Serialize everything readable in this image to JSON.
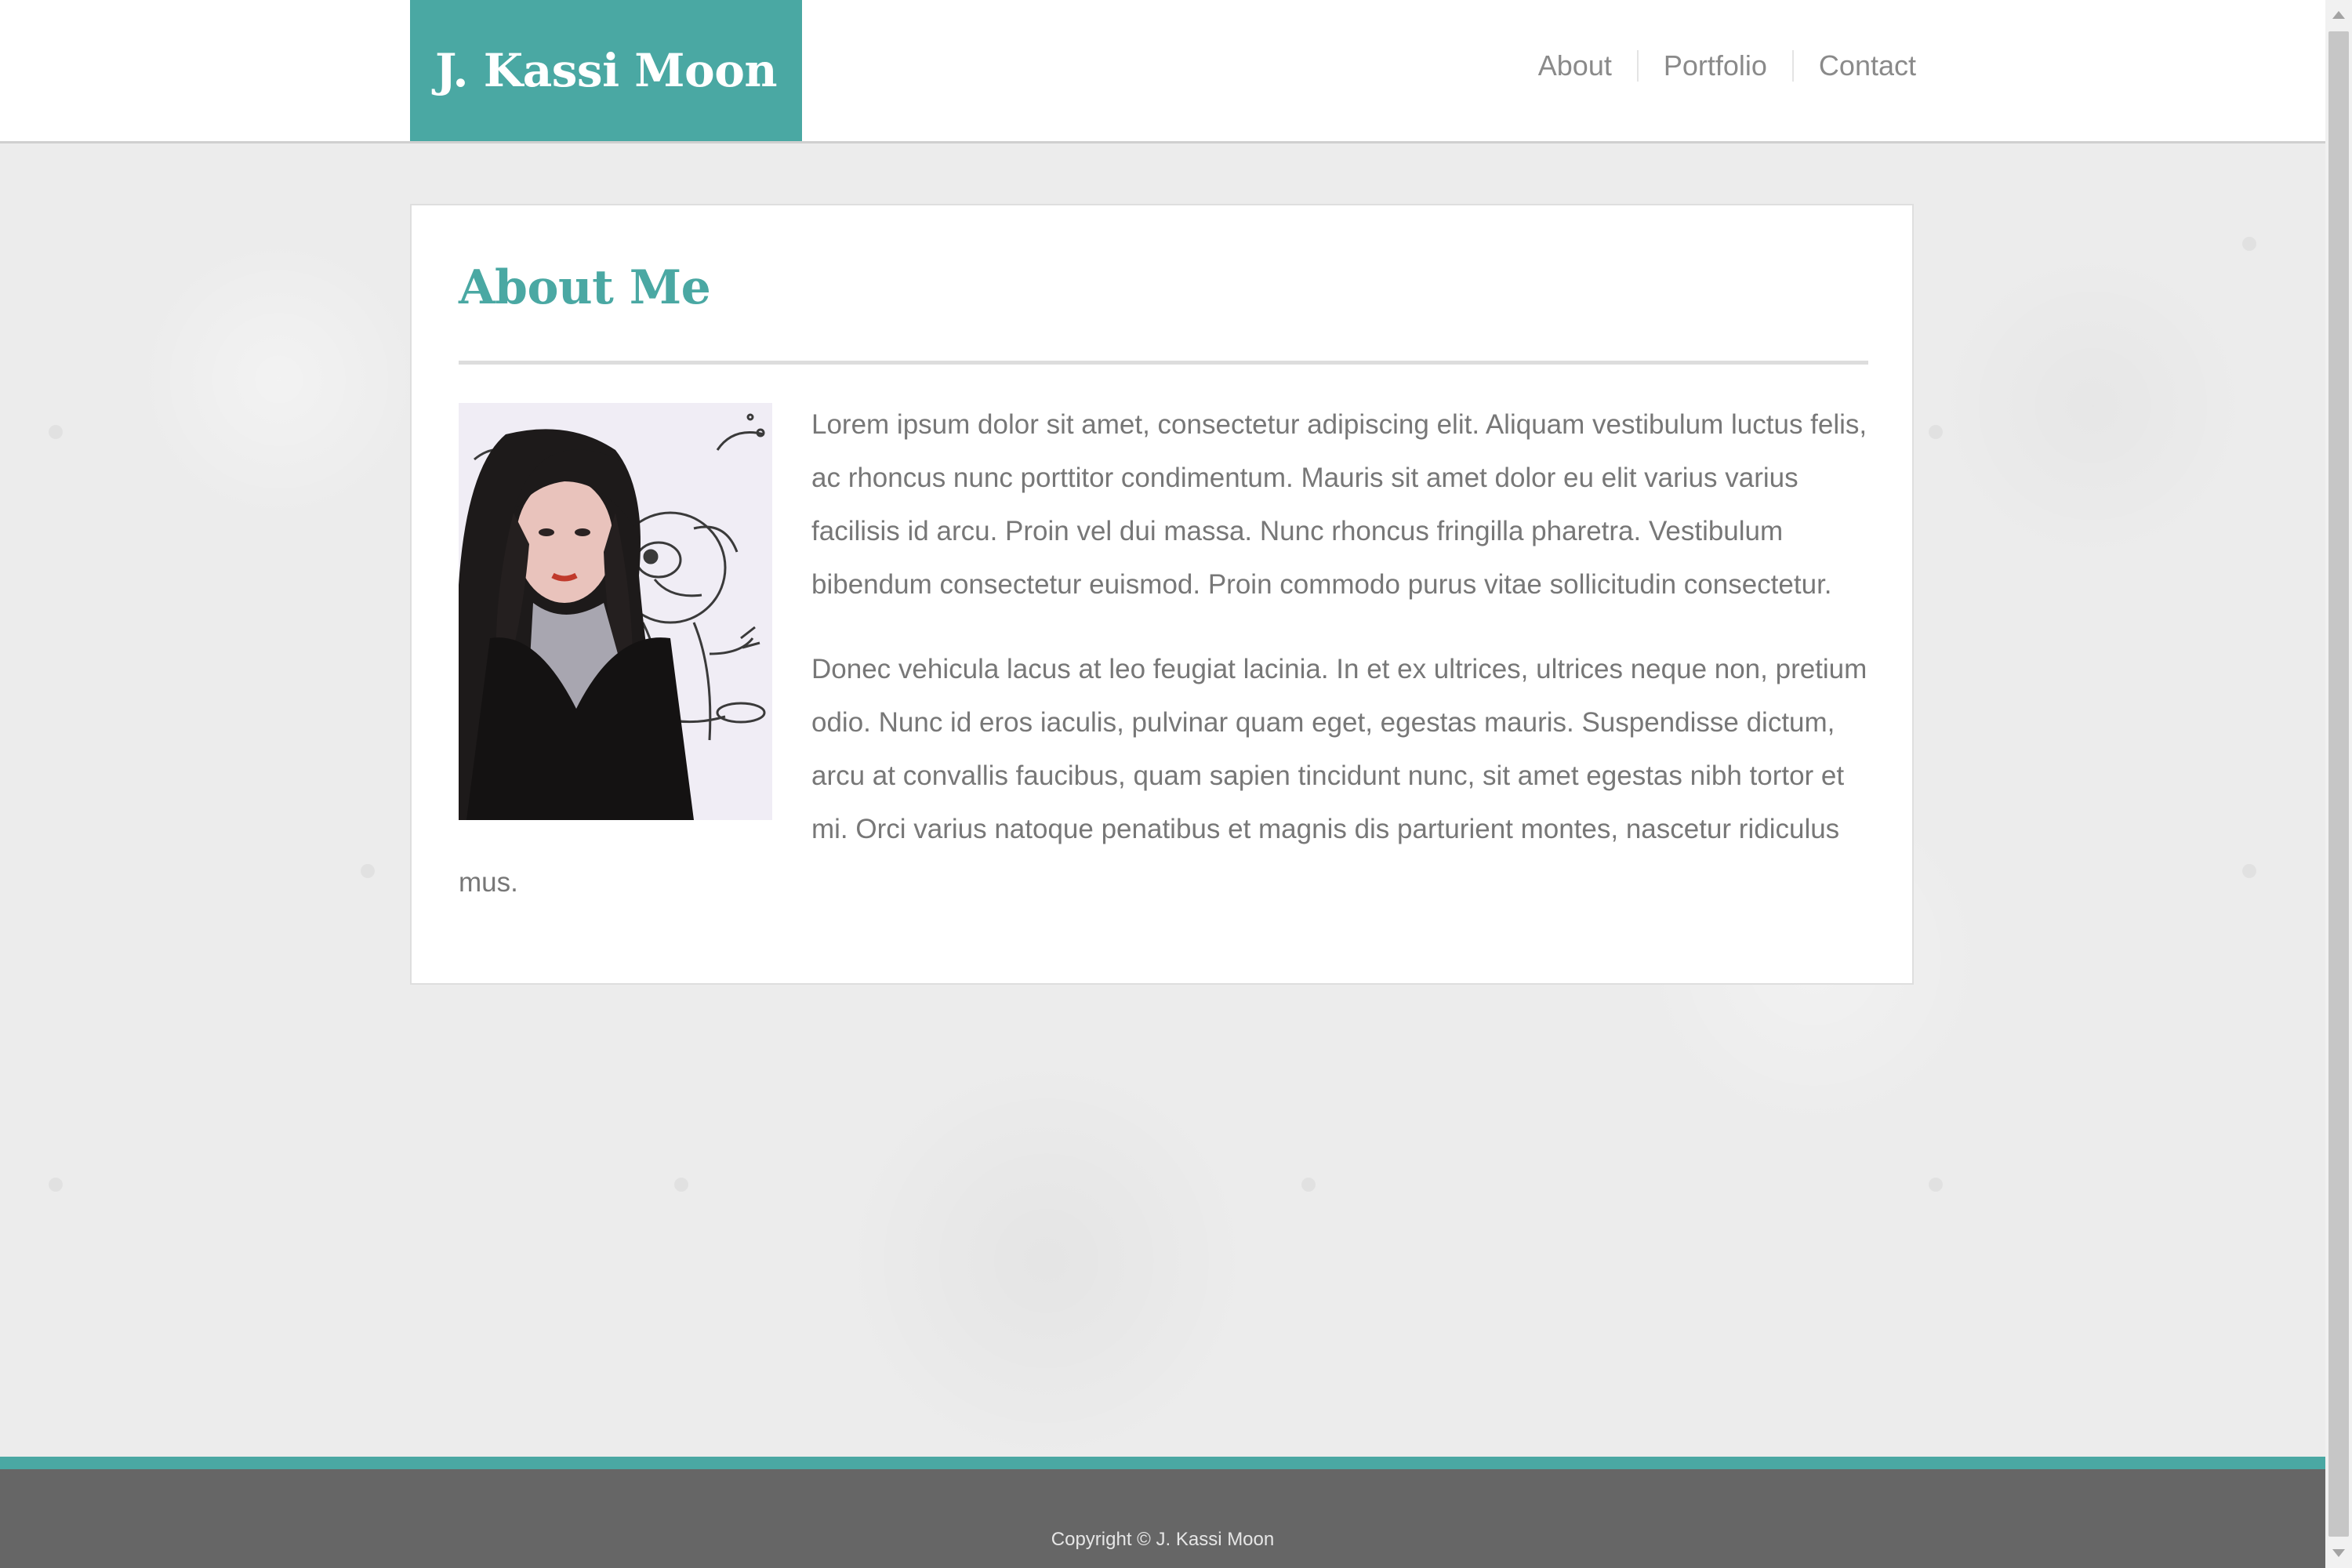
{
  "header": {
    "brand": "J. Kassi Moon",
    "nav": [
      {
        "label": "About"
      },
      {
        "label": "Portfolio"
      },
      {
        "label": "Contact"
      }
    ]
  },
  "main": {
    "title": "About Me",
    "paragraphs": [
      "Lorem ipsum dolor sit amet, consectetur adipiscing elit. Aliquam vestibulum luctus felis, ac rhoncus nunc porttitor condimentum. Mauris sit amet dolor eu elit varius varius facilisis id arcu. Proin vel dui massa. Nunc rhoncus fringilla pharetra. Vestibulum bibendum consectetur euismod. Proin commodo purus vitae sollicitudin consectetur.",
      "Donec vehicula lacus at leo feugiat lacinia. In et ex ultrices, ultrices neque non, pretium odio. Nunc id eros iaculis, pulvinar quam eget, egestas mauris. Suspendisse dictum, arcu at convallis faucibus, quam sapien tincidunt nunc, sit amet egestas nibh tortor et mi. Orci varius natoque penatibus et magnis dis parturient montes, nascetur ridiculus mus."
    ],
    "photo_icon": "portrait-photo"
  },
  "footer": {
    "copyright": "Copyright © J. Kassi Moon"
  },
  "colors": {
    "accent": "#4aa8a3",
    "footer": "#666666",
    "text": "#777777",
    "background": "#ececec"
  }
}
